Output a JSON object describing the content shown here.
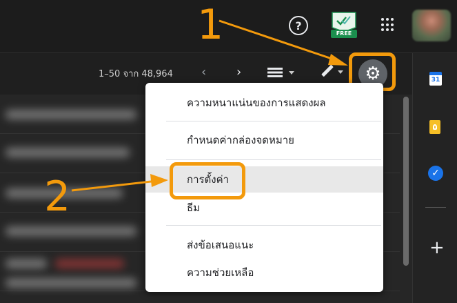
{
  "header": {
    "help_icon": "help-circle-icon",
    "help_glyph": "?",
    "extension_badge": "FREE",
    "apps_icon": "apps-grid-icon"
  },
  "toolbar": {
    "page_count": "1–50 จาก 48,964",
    "prev_glyph": "‹",
    "next_glyph": "›",
    "density_icon": "density-icon",
    "compose_icon": "pencil-icon",
    "settings_icon": "gear-icon",
    "settings_glyph": "⚙"
  },
  "settings_menu": {
    "items": [
      {
        "label": "ความหนาแน่นของการแสดงผล"
      },
      {
        "label": "กำหนดค่ากล่องจดหมาย"
      },
      {
        "label": "การตั้งค่า"
      },
      {
        "label": "ธีม"
      },
      {
        "label": "ส่งข้อเสนอแนะ"
      },
      {
        "label": "ความช่วยเหลือ"
      }
    ],
    "active_index": 2
  },
  "right_rail": {
    "calendar_day": "31",
    "tasks_glyph": "✓",
    "add_glyph": "+"
  },
  "annotations": {
    "step1": "1",
    "step2": "2"
  },
  "colors": {
    "highlight": "#f39a0c",
    "menu_bg": "#ffffff",
    "topbar_bg": "#1c1c1c"
  }
}
